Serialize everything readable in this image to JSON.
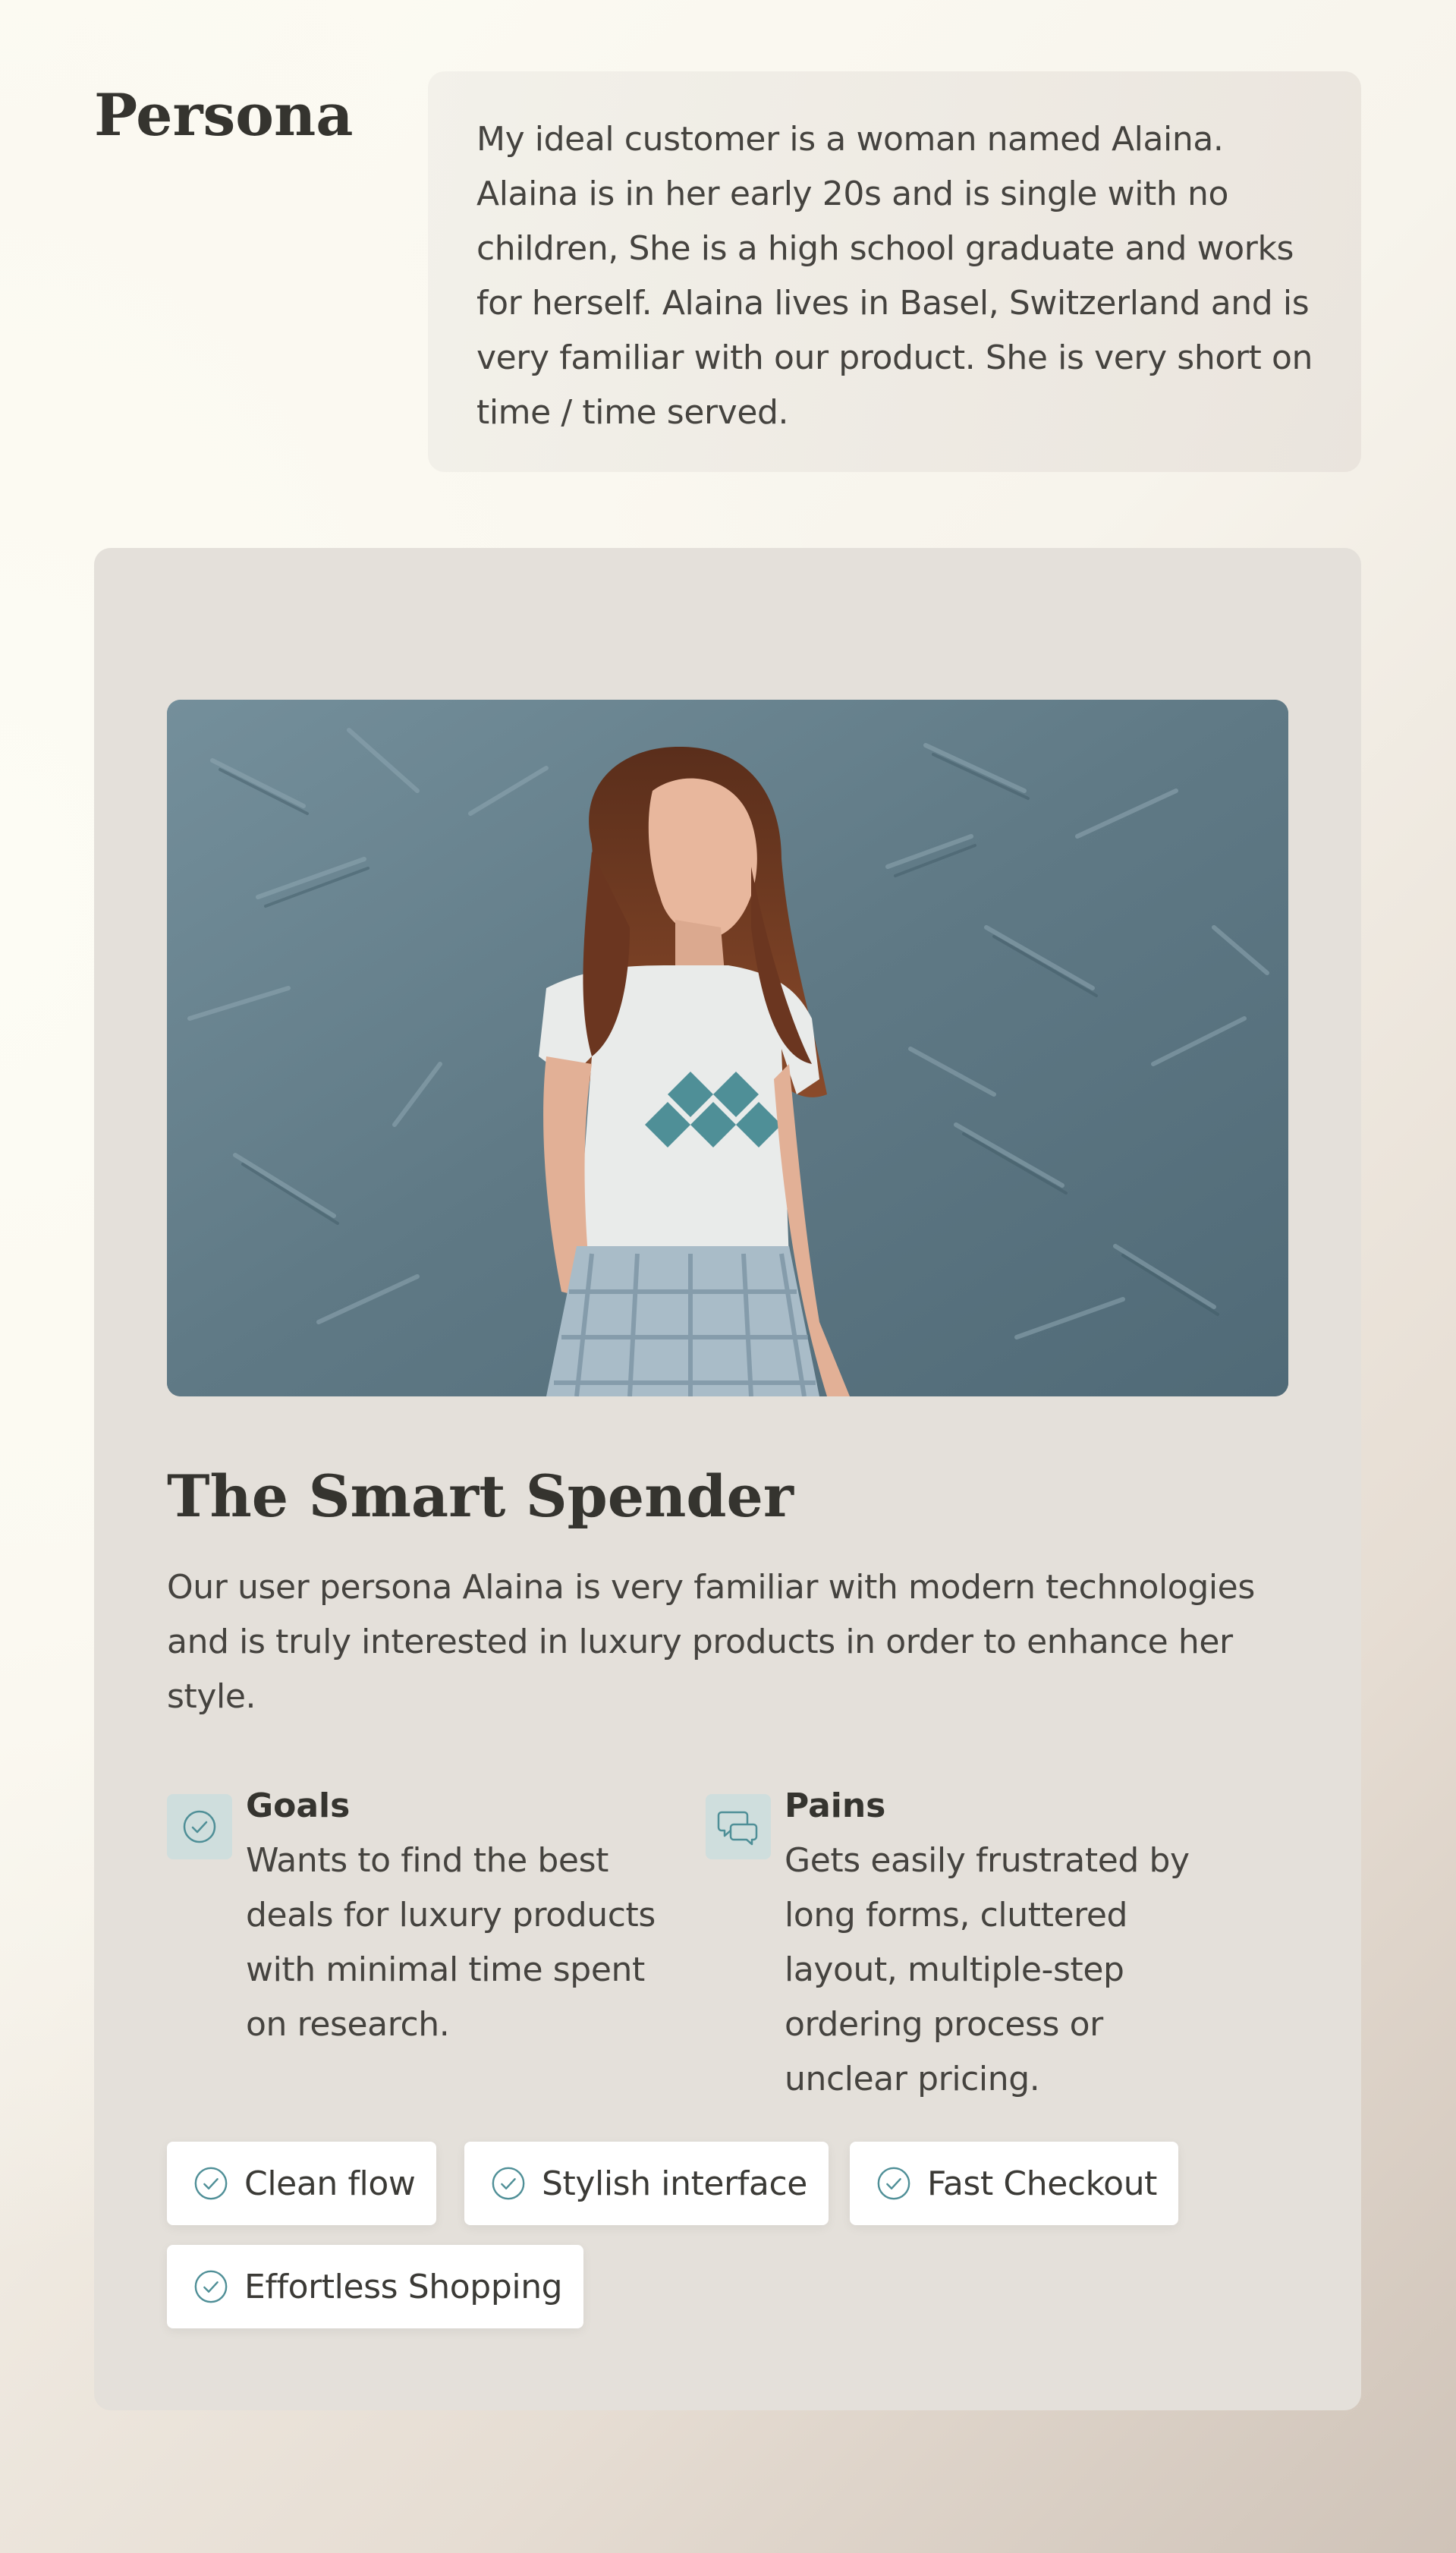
{
  "page": {
    "title": "Persona",
    "intro": "My ideal customer is a woman named Alaina. Alaina is in her early 20s and is single with no children, She is a high school graduate and works for herself. Alaina lives in Basel, Switzerland and is very familiar with our product. She is very short on time / time served."
  },
  "persona": {
    "image_alt": "Young woman with long curly auburn hair leaning against a textured blue-gray wall",
    "name": "The Smart Spender",
    "description": "Our user persona Alaina is very familiar with modern technologies and is truly interested in luxury products in order to enhance her style.",
    "goals": {
      "icon": "check-circle-icon",
      "title": "Goals",
      "text": "Wants to find the best deals for luxury products with minimal time spent on research."
    },
    "pains": {
      "icon": "chat-bubbles-icon",
      "title": "Pains",
      "text": "Gets easily frustrated by long forms, cluttered layout, multiple-step ordering process or unclear pricing."
    },
    "tags": [
      {
        "label": "Clean flow",
        "icon": "check-circle-icon"
      },
      {
        "label": "Stylish interface",
        "icon": "check-circle-icon"
      },
      {
        "label": "Fast Checkout",
        "icon": "check-circle-icon"
      },
      {
        "label": "Effortless Shopping",
        "icon": "check-circle-icon"
      }
    ]
  },
  "colors": {
    "accent": "#4f8f97",
    "icon_bg": "#cfdedd",
    "card_bg": "#e4e0da",
    "text": "#3b3a36"
  }
}
